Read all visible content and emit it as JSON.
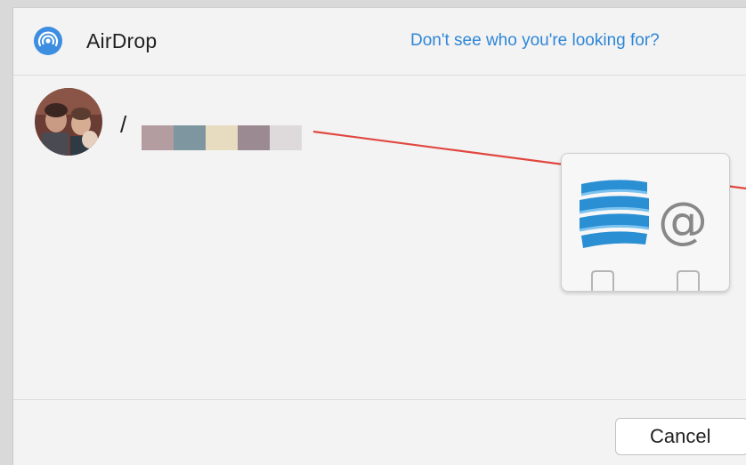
{
  "window": {
    "title": "AirDrop",
    "help_link": "Don't see who you're looking for?"
  },
  "contact": {
    "name_visible_fragment": "/",
    "name_obscured": true,
    "avatar": "contact-photo"
  },
  "dragged_file": {
    "icon": "att-mail-at-icon"
  },
  "footer": {
    "cancel_label": "Cancel"
  },
  "colors": {
    "accent": "#2f86d6",
    "drag_line": "#e0473f",
    "background": "#f3f3f3",
    "obscure_pixels": [
      "#b49da0",
      "#7d96a0",
      "#e8dcc0",
      "#9c8a93",
      "#dedadc"
    ]
  }
}
